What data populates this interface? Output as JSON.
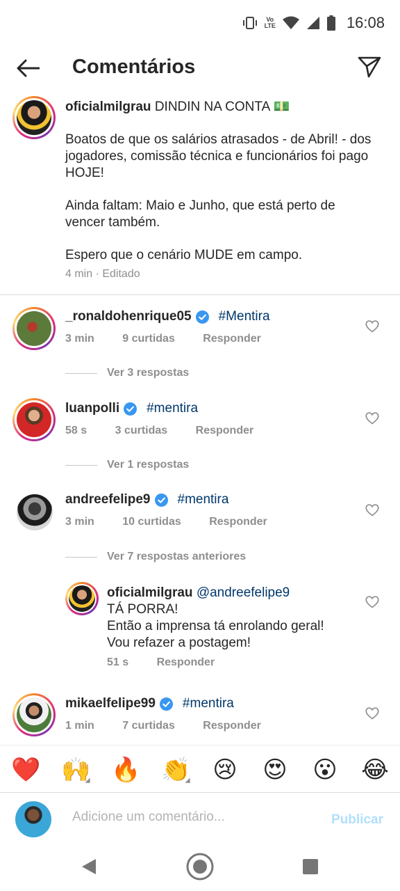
{
  "status_bar": {
    "time": "16:08",
    "volte_top": "Vo",
    "volte_bottom": "LTE"
  },
  "header": {
    "title": "Comentários"
  },
  "post": {
    "username": "oficialmilgrau",
    "first_line": "DINDIN NA CONTA 💵",
    "paragraphs": [
      "Boatos de que os salários atrasados - de Abril! - dos jogadores, comissão técnica e funcionários foi pago HOJE!",
      "Ainda faltam: Maio e Junho, que está perto de vencer também.",
      "Espero que o cenário MUDE em campo."
    ],
    "meta": "4 min · Editado"
  },
  "comments": [
    {
      "username": "_ronaldohenrique05",
      "text": "#Mentira",
      "time": "3 min",
      "likes": "9 curtidas",
      "reply_label": "Responder",
      "view_replies": "Ver 3 respostas"
    },
    {
      "username": "luanpolli",
      "text": "#mentira",
      "time": "58 s",
      "likes": "3 curtidas",
      "reply_label": "Responder",
      "view_replies": "Ver 1 respostas"
    },
    {
      "username": "andreefelipe9",
      "text": "#mentira",
      "time": "3 min",
      "likes": "10 curtidas",
      "reply_label": "Responder",
      "view_replies": "Ver 7 respostas anteriores"
    },
    {
      "username": "mikaelfelipe99",
      "text": "#mentira",
      "time": "1 min",
      "likes": "7 curtidas",
      "reply_label": "Responder"
    }
  ],
  "reply": {
    "username": "oficialmilgrau",
    "mention": "@andreefelipe9",
    "lines": [
      "TÁ PORRA!",
      "Então a imprensa tá enrolando geral!",
      "Vou refazer a postagem!"
    ],
    "time": "51 s",
    "reply_label": "Responder"
  },
  "emoji_bar": [
    "❤️",
    "🙌",
    "🔥",
    "👏",
    "😢",
    "😍",
    "😮",
    "😂"
  ],
  "composer": {
    "placeholder": "Adicione um comentário...",
    "publish_label": "Publicar"
  },
  "colors": {
    "link": "#00376b",
    "meta": "#8e8e8e",
    "verified": "#3897f0",
    "publish_disabled": "#b2dffc"
  }
}
